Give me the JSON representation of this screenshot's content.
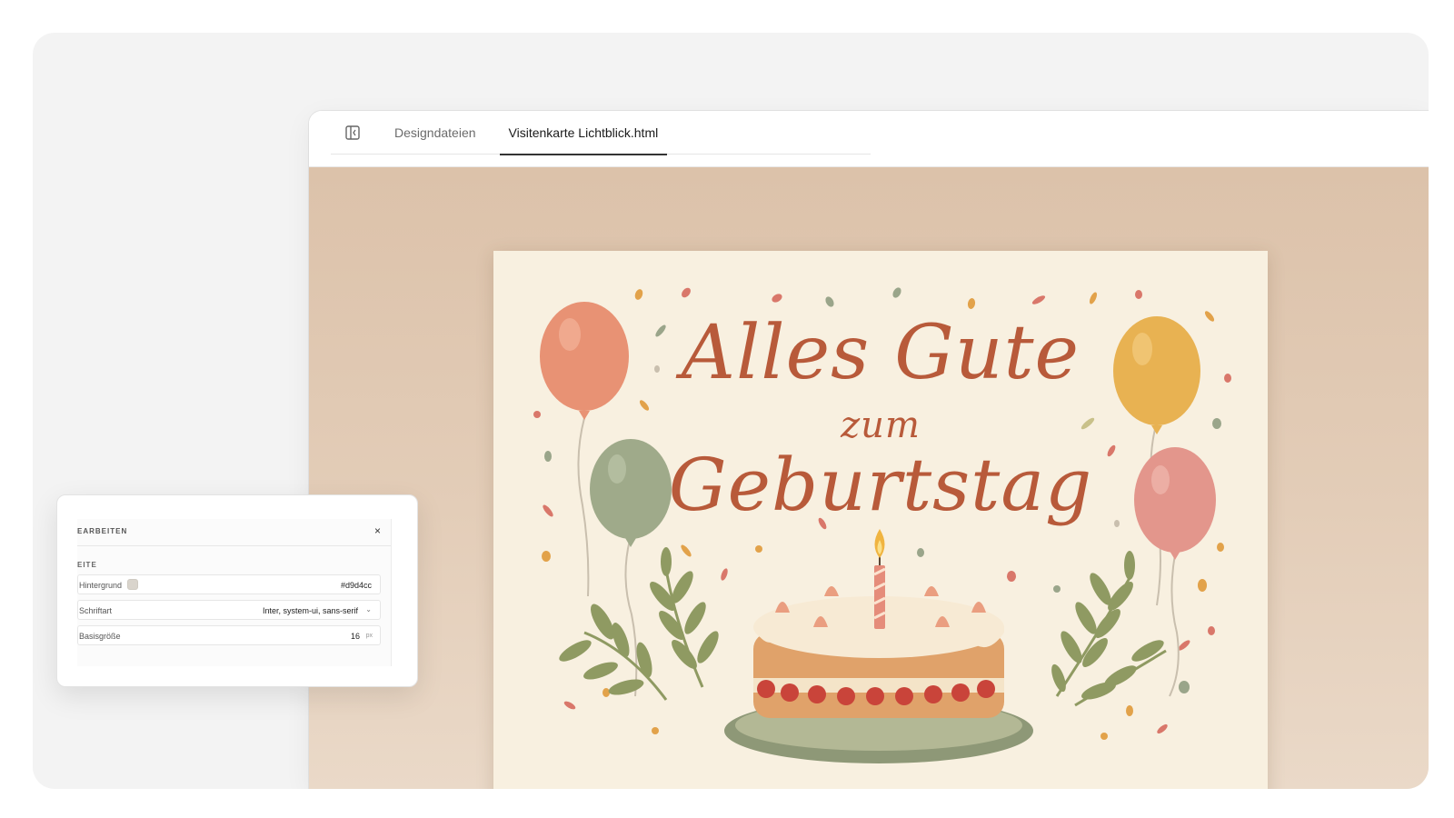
{
  "tabs": {
    "design_files": "Designdateien",
    "active_file": "Visitenkarte Lichtblick.html"
  },
  "card": {
    "line1": "Alles Gute",
    "line2": "zum",
    "line3": "Geburtstag"
  },
  "edit_panel": {
    "title": "EARBEITEN",
    "close": "×",
    "section": "EITE",
    "background_label": "Hintergrund",
    "background_value": "#d9d4cc",
    "font_label": "Schriftart",
    "font_value": "Inter, system-ui, sans-serif",
    "base_size_label": "Basisgröße",
    "base_size_value": "16",
    "base_size_unit": "px"
  },
  "colors": {
    "title": "#b85a3a",
    "card": "#f8f0e0",
    "canvas": "#dcc2aa"
  },
  "icons": {
    "panel_toggle": "sidebar-toggle-icon",
    "close": "close-icon",
    "dropdown": "chevron-down-icon"
  }
}
